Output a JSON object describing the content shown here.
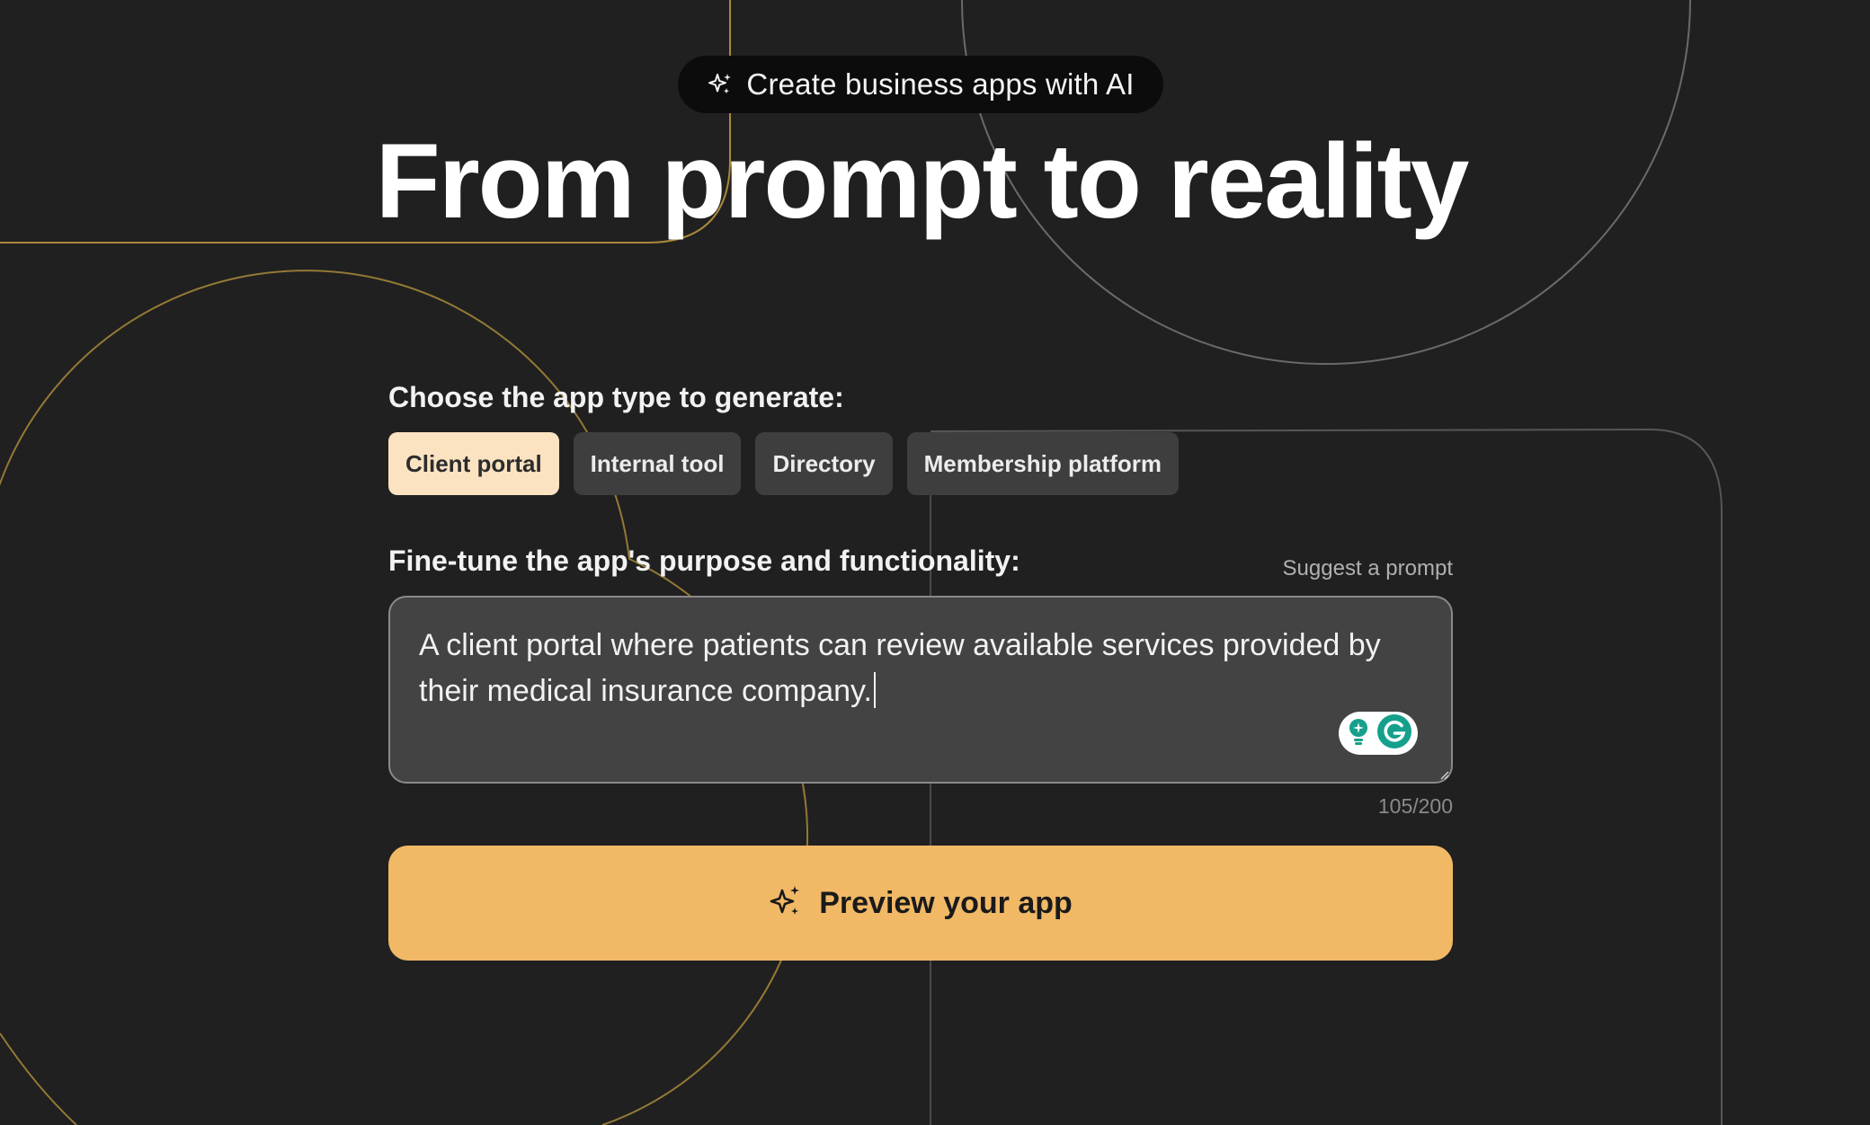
{
  "header": {
    "badge_icon": "sparkles-icon",
    "badge_text": "Create business apps with AI",
    "title": "From prompt to reality"
  },
  "app_type": {
    "label": "Choose the app type to generate:",
    "options": [
      {
        "label": "Client portal",
        "selected": true
      },
      {
        "label": "Internal tool",
        "selected": false
      },
      {
        "label": "Directory",
        "selected": false
      },
      {
        "label": "Membership platform",
        "selected": false
      }
    ]
  },
  "prompt": {
    "label": "Fine-tune the app's purpose and functionality:",
    "suggest_label": "Suggest a prompt",
    "value": "A client portal where patients can review available services provided by their medical insurance company.",
    "counter": "105/200"
  },
  "cta": {
    "icon": "sparkles-icon",
    "label": "Preview your app"
  },
  "colors": {
    "background": "#202020",
    "accent": "#f1b966",
    "chip_active": "#fbe3c2",
    "chip": "#3e3e3e",
    "gold_line": "#b8943a"
  }
}
